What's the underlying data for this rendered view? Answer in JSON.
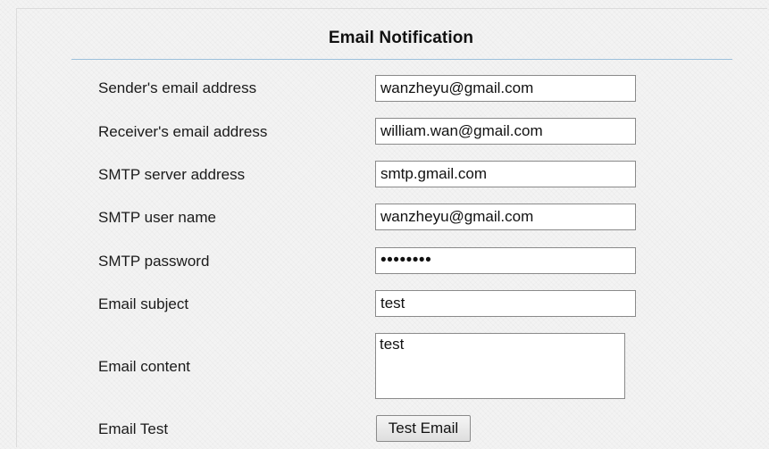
{
  "section": {
    "title": "Email Notification"
  },
  "form": {
    "sender_email": {
      "label": "Sender's email address",
      "value": "wanzheyu@gmail.com"
    },
    "receiver_email": {
      "label": "Receiver's email address",
      "value": "william.wan@gmail.com"
    },
    "smtp_server": {
      "label": "SMTP server address",
      "value": "smtp.gmail.com"
    },
    "smtp_user": {
      "label": "SMTP user name",
      "value": "wanzheyu@gmail.com"
    },
    "smtp_password": {
      "label": "SMTP password",
      "value": "••••••••"
    },
    "email_subject": {
      "label": "Email subject",
      "value": "test"
    },
    "email_content": {
      "label": "Email content",
      "value": "test"
    },
    "email_test": {
      "label": "Email Test",
      "button_label": "Test Email"
    }
  }
}
